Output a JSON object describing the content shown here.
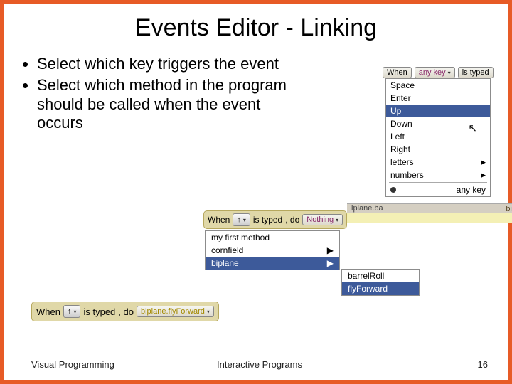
{
  "title": "Events Editor - Linking",
  "bullets": [
    "Select which key triggers the event",
    "Select which method in the program should be called when the event occurs"
  ],
  "fig1": {
    "header_when": "When",
    "header_key": "any key",
    "header_typed": "is typed",
    "menu": {
      "space": "Space",
      "enter": "Enter",
      "up": "Up",
      "down": "Down",
      "left": "Left",
      "right": "Right",
      "letters": "letters",
      "numbers": "numbers",
      "anykey": "any key"
    },
    "strip_label": "iplane.ba",
    "strip_bip": "bip"
  },
  "fig2": {
    "when": "When",
    "key_arrow": "↑",
    "is_typed": "is typed",
    "do": ", do",
    "nothing": "Nothing",
    "menu": {
      "myfirst": "my first method",
      "cornfield": "cornfield",
      "biplane": "biplane"
    },
    "submenu": {
      "barrelRoll": "barrelRoll",
      "flyForward": "flyForward"
    }
  },
  "fig3": {
    "when": "When",
    "key_arrow": "↑",
    "is_typed": "is typed",
    "do": ", do",
    "method": "biplane.flyForward"
  },
  "footer": {
    "left": "Visual Programming",
    "center": "Interactive Programs",
    "page": "16"
  }
}
